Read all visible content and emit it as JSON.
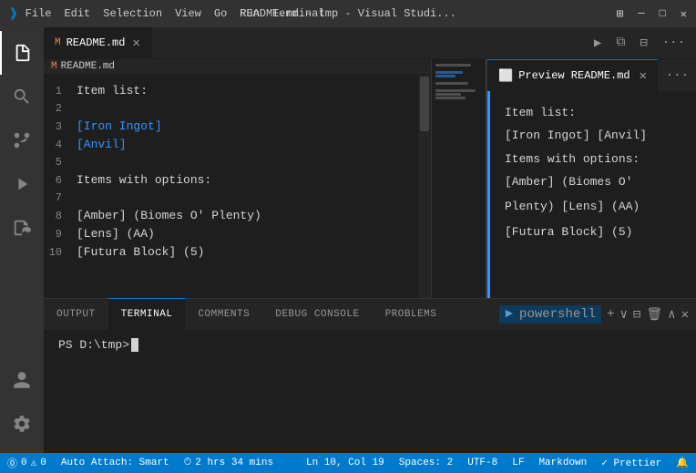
{
  "titlebar": {
    "logo": "VS",
    "menu": [
      "File",
      "Edit",
      "Selection",
      "View",
      "Go",
      "Run",
      "Terminal"
    ],
    "title": "README.md - tmp - Visual Studi...",
    "controls": {
      "minimize": "─",
      "maximize": "□",
      "close": "✕"
    }
  },
  "editor": {
    "tabs": [
      {
        "id": "readme-md",
        "icon": "M",
        "label": "README.md",
        "active": true,
        "modified": false
      },
      {
        "id": "preview-readme-md",
        "icon": "⬜",
        "label": "Preview README.md",
        "active": true,
        "preview": true
      }
    ],
    "breadcrumb": "README.md",
    "lines": [
      {
        "num": "1",
        "content": "Item list:"
      },
      {
        "num": "2",
        "content": ""
      },
      {
        "num": "3",
        "content": "[Iron Ingot]"
      },
      {
        "num": "4",
        "content": "[Anvil]"
      },
      {
        "num": "5",
        "content": ""
      },
      {
        "num": "6",
        "content": "Items with options:"
      },
      {
        "num": "7",
        "content": ""
      },
      {
        "num": "8",
        "content": "[Amber] (Biomes O' Plenty)"
      },
      {
        "num": "9",
        "content": "[Lens] (AA)"
      },
      {
        "num": "10",
        "content": "[Futura Block] (5)"
      }
    ]
  },
  "preview": {
    "title": "Preview README.md",
    "content": {
      "heading1": "Item list:",
      "list1": "[Iron Ingot] [Anvil]",
      "heading2": "Items with options:",
      "list2": "[Amber] (Biomes O'",
      "list2b": "Plenty) [Lens] (AA)",
      "list3": "[Futura Block] (5)"
    }
  },
  "panel": {
    "tabs": [
      {
        "id": "output",
        "label": "OUTPUT",
        "active": false
      },
      {
        "id": "terminal",
        "label": "TERMINAL",
        "active": true
      },
      {
        "id": "comments",
        "label": "COMMENTS",
        "active": false
      },
      {
        "id": "debug-console",
        "label": "DEBUG CONSOLE",
        "active": false
      },
      {
        "id": "problems",
        "label": "PROBLEMS",
        "active": false
      }
    ],
    "terminal": {
      "shell": "powershell",
      "prompt": "PS D:\\tmp> "
    }
  },
  "statusbar": {
    "left": [
      {
        "id": "git",
        "text": "⓪ 0  ⚠ 0"
      },
      {
        "id": "autoattach",
        "text": "Auto Attach: Smart"
      },
      {
        "id": "time",
        "icon": "⏱",
        "text": "2 hrs 34 mins"
      }
    ],
    "right": [
      {
        "id": "cursor",
        "text": "Ln 10, Col 19"
      },
      {
        "id": "spaces",
        "text": "Spaces: 2"
      },
      {
        "id": "encoding",
        "text": "UTF-8"
      },
      {
        "id": "eol",
        "text": "LF"
      },
      {
        "id": "language",
        "text": "Markdown"
      },
      {
        "id": "prettier",
        "text": "✓ Prettier"
      },
      {
        "id": "bell",
        "text": "🔔"
      }
    ]
  }
}
